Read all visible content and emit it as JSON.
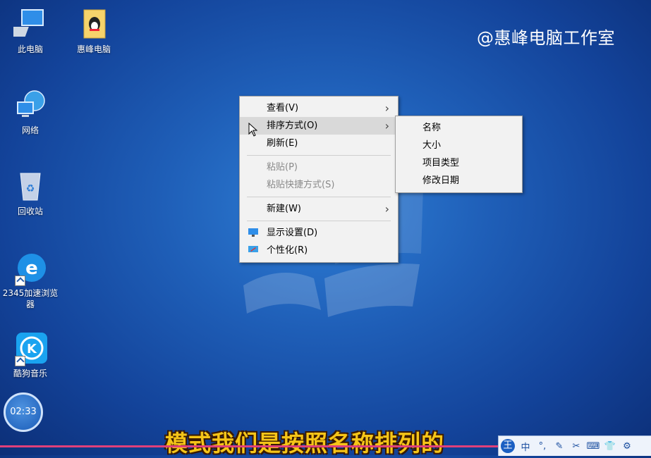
{
  "watermark": "@惠峰电脑工作室",
  "desktop_icons": [
    {
      "label": "此电脑",
      "icon": "this-pc-icon"
    },
    {
      "label": "惠峰电脑",
      "icon": "qq-folder-icon"
    },
    {
      "label": "网络",
      "icon": "network-icon"
    },
    {
      "label": "回收站",
      "icon": "recycle-bin-icon"
    },
    {
      "label": "2345加速浏览器",
      "icon": "browser-2345-icon"
    },
    {
      "label": "酷狗音乐",
      "icon": "kugou-music-icon"
    }
  ],
  "context_menu": {
    "view": "查看(V)",
    "sort_by": "排序方式(O)",
    "refresh": "刷新(E)",
    "paste": "粘贴(P)",
    "paste_shortcut": "粘贴快捷方式(S)",
    "new": "新建(W)",
    "display_settings": "显示设置(D)",
    "personalize": "个性化(R)"
  },
  "sort_submenu": [
    "名称",
    "大小",
    "项目类型",
    "修改日期"
  ],
  "subtitle": "模式我们是按照名称排列的",
  "clock": "02:33",
  "ime_toolbar": [
    "王",
    "中",
    "°,",
    "✎",
    "✂",
    "⌨",
    "👕",
    "⚙"
  ]
}
